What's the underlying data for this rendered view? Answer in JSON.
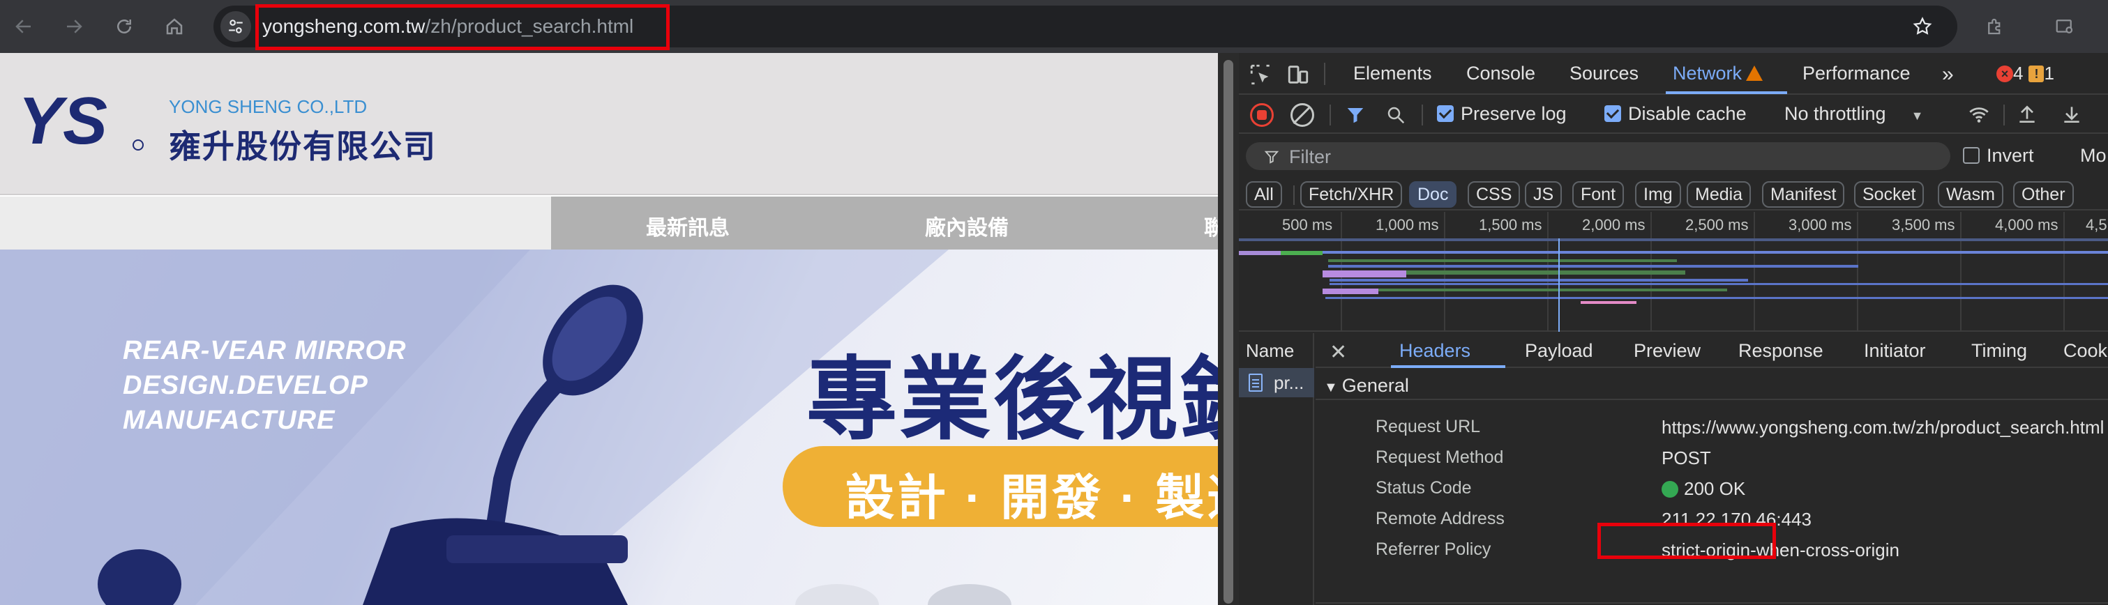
{
  "browser": {
    "url_host": "yongsheng.com.tw",
    "url_path": "/zh/product_search.html"
  },
  "site": {
    "logo_mark": "YS",
    "logo_en": "YONG SHENG CO.,LTD",
    "logo_zh": "雍升股份有限公司",
    "nav": [
      "最新訊息",
      "廠內設備",
      "聯"
    ],
    "hero_tagline": [
      "REAR-VEAR MIRROR",
      "DESIGN.DEVELOP",
      "MANUFACTURE"
    ],
    "hero_title": "專業後視鏡",
    "hero_subtitle": "設計 · 開發 · 製造"
  },
  "devtools": {
    "tabs": [
      "Elements",
      "Console",
      "Sources",
      "Network",
      "Performance"
    ],
    "errors": "4",
    "warnings": "1",
    "toolbar": {
      "preserve_log": "Preserve log",
      "disable_cache": "Disable cache",
      "throttling": "No throttling"
    },
    "filter_placeholder": "Filter",
    "invert": "Invert",
    "more": "Mo",
    "types": [
      "All",
      "Fetch/XHR",
      "Doc",
      "CSS",
      "JS",
      "Font",
      "Img",
      "Media",
      "Manifest",
      "Socket",
      "Wasm",
      "Other"
    ],
    "active_type": "Doc",
    "timeline_ticks": [
      "500 ms",
      "1,000 ms",
      "1,500 ms",
      "2,000 ms",
      "2,500 ms",
      "3,000 ms",
      "3,500 ms",
      "4,000 ms",
      "4,5"
    ],
    "name_header": "Name",
    "request_name": "pr...",
    "detail_tabs": [
      "Headers",
      "Payload",
      "Preview",
      "Response",
      "Initiator",
      "Timing",
      "Cookies"
    ],
    "general_label": "General",
    "general": [
      {
        "key": "Request URL",
        "value": "https://www.yongsheng.com.tw/zh/product_search.html"
      },
      {
        "key": "Request Method",
        "value": "POST"
      },
      {
        "key": "Status Code",
        "value": "200 OK"
      },
      {
        "key": "Remote Address",
        "value": "211.22.170.46:443"
      },
      {
        "key": "Referrer Policy",
        "value": "strict-origin-when-cross-origin"
      }
    ]
  }
}
